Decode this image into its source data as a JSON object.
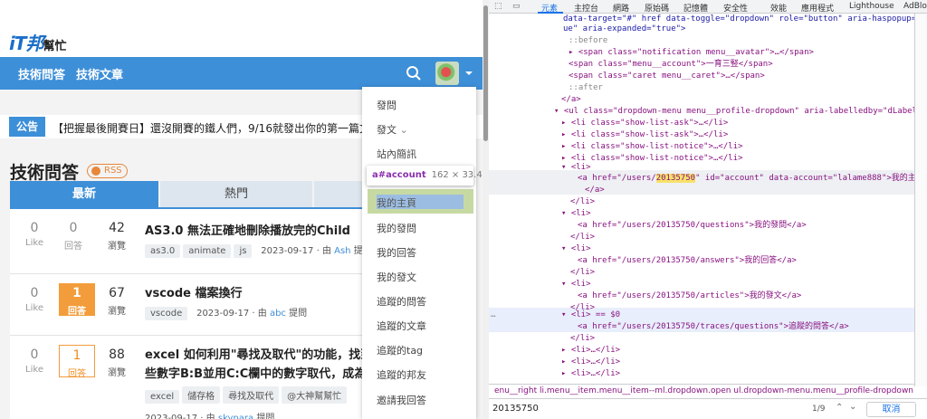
{
  "site": {
    "logo_main": "iT邦",
    "logo_sub": "幫忙",
    "nav": [
      "技術問答",
      "技術文章"
    ],
    "notice_badge": "公告",
    "notice_text": "【把握最後開賽日】還沒開賽的鐵人們，9/16就發出你的第一篇文章"
  },
  "section": {
    "title": "技術問答",
    "rss": "RSS",
    "tabs": [
      "最新",
      "熱門"
    ]
  },
  "questions": [
    {
      "likes": "0",
      "like_label": "Like",
      "answers": "0",
      "answer_label": "回答",
      "views": "42",
      "view_label": "瀏覽",
      "title": "AS3.0 無法正確地刪除播放完的Child",
      "tags": [
        "as3.0",
        "animate",
        "js"
      ],
      "date": "2023-09-17",
      "by": "由",
      "user": "Ash",
      "action": "提問"
    },
    {
      "likes": "0",
      "like_label": "Like",
      "answers": "1",
      "answer_label": "回答",
      "views": "67",
      "view_label": "瀏覽",
      "title": "vscode 檔案換行",
      "tags": [
        "vscode"
      ],
      "date": "2023-09-17",
      "by": "由",
      "user": "abc",
      "action": "提問"
    },
    {
      "likes": "0",
      "like_label": "Like",
      "answers": "1",
      "answer_label": "回答",
      "views": "88",
      "view_label": "瀏覽",
      "title": "excel 如何利用\"尋找及取代\"的功能，找到",
      "title2": "些數字B:B並用C:C欄中的數字取代，成為",
      "tags": [
        "excel",
        "儲存格",
        "尋找及取代",
        "@大神幫幫忙"
      ],
      "date": "2023-09-17",
      "by": "由",
      "user": "skypara",
      "action": "提問"
    }
  ],
  "menu": [
    "發問",
    "發文",
    "站內簡訊",
    "我的主頁",
    "我的發問",
    "我的回答",
    "我的發文",
    "追蹤的問答",
    "追蹤的文章",
    "追蹤的tag",
    "追蹤的邦友",
    "邀請我回答"
  ],
  "tooltip": {
    "selector": "a#account",
    "size": "162 × 33.42"
  },
  "devtools": {
    "tabs": [
      "元素",
      "主控台",
      "網路",
      "原始碼",
      "記憶體",
      "安全性",
      "效能",
      "應用程式",
      "Lighthouse",
      "AdBlock"
    ],
    "lines": [
      "data-target=\"#\" href data-toggle=\"dropdown\" role=\"button\" aria-haspopup=\"tr",
      "ue\" aria-expanded=\"true\">",
      "::before",
      "<span class=\"notification menu__avatar\">…</span>",
      "<span class=\"menu__account\">一育三竪</span>",
      "<span class=\"caret menu__caret\">…</span>",
      "::after",
      "</a>",
      "<ul class=\"dropdown-menu menu__profile-dropdown\" aria-labelledby=\"dLabel\">",
      "<li class=\"show-list-ask\">…</li>",
      "<li class=\"show-list-ask\">…</li>",
      "<li class=\"show-list-notice\">…</li>",
      "<li class=\"show-list-notice\">…</li>",
      "<li>",
      "<a href=\"/users/20135750\" id=\"account\" data-account=\"lalame888\">我的主頁",
      "</a>",
      "</li>",
      "<li>",
      "<a href=\"/users/20135750/questions\">我的發問</a>",
      "</li>",
      "<li>",
      "<a href=\"/users/20135750/answers\">我的回答</a>",
      "</li>",
      "<li>",
      "<a href=\"/users/20135750/articles\">我的發文</a>",
      "</li>",
      "<li> == $0",
      "<a href=\"/users/20135750/traces/questions\">追蹤的問答</a>",
      "</li>",
      "<li>…</li>",
      "<li>…</li>",
      "<li>…</li>"
    ],
    "breadcrumbs": "enu__right   li.menu__item.menu__item--ml.dropdown.open   ul.dropdown-menu.menu__profile-dropdown   li",
    "find_value": "20135750",
    "find_count": "1/9",
    "find_cancel": "取消"
  }
}
